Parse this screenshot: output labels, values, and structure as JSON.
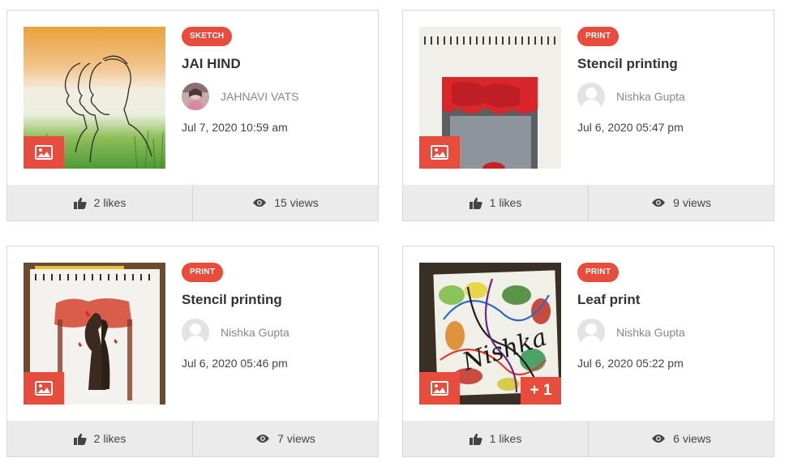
{
  "cards": [
    {
      "tag": "SKETCH",
      "title": "JAI HIND",
      "author": "JAHNAVI VATS",
      "date": "Jul 7, 2020 10:59 am",
      "likes": "2 likes",
      "views": "15 views",
      "image_subject": "sketch of three soldiers in profile over tricolour background",
      "avatar": "photo-avatar"
    },
    {
      "tag": "PRINT",
      "title": "Stencil printing",
      "author": "Nishka Gupta",
      "date": "Jul 6, 2020 05:47 pm",
      "likes": "1 likes",
      "views": "9 views",
      "image_subject": "stencil print of red tree canopy on spiral notebook",
      "avatar": "default-avatar"
    },
    {
      "tag": "PRINT",
      "title": "Stencil printing",
      "author": "Nishka Gupta",
      "date": "Jul 6, 2020 05:46 pm",
      "likes": "2 likes",
      "views": "7 views",
      "image_subject": "stencil print of couple silhouette under red trees",
      "avatar": "default-avatar"
    },
    {
      "tag": "PRINT",
      "title": "Leaf print",
      "author": "Nishka Gupta",
      "date": "Jul 6, 2020 05:22 pm",
      "likes": "1 likes",
      "views": "6 views",
      "image_subject": "colourful leaf print with handwritten name",
      "avatar": "default-avatar",
      "extra_images": "+ 1"
    }
  ],
  "colors": {
    "accent": "#e74c3c",
    "footer_bg": "#ebebeb",
    "text": "#333333",
    "muted": "#888888"
  },
  "icons": {
    "image_badge": "image-icon",
    "likes": "thumbs-up-icon",
    "views": "eye-icon"
  }
}
